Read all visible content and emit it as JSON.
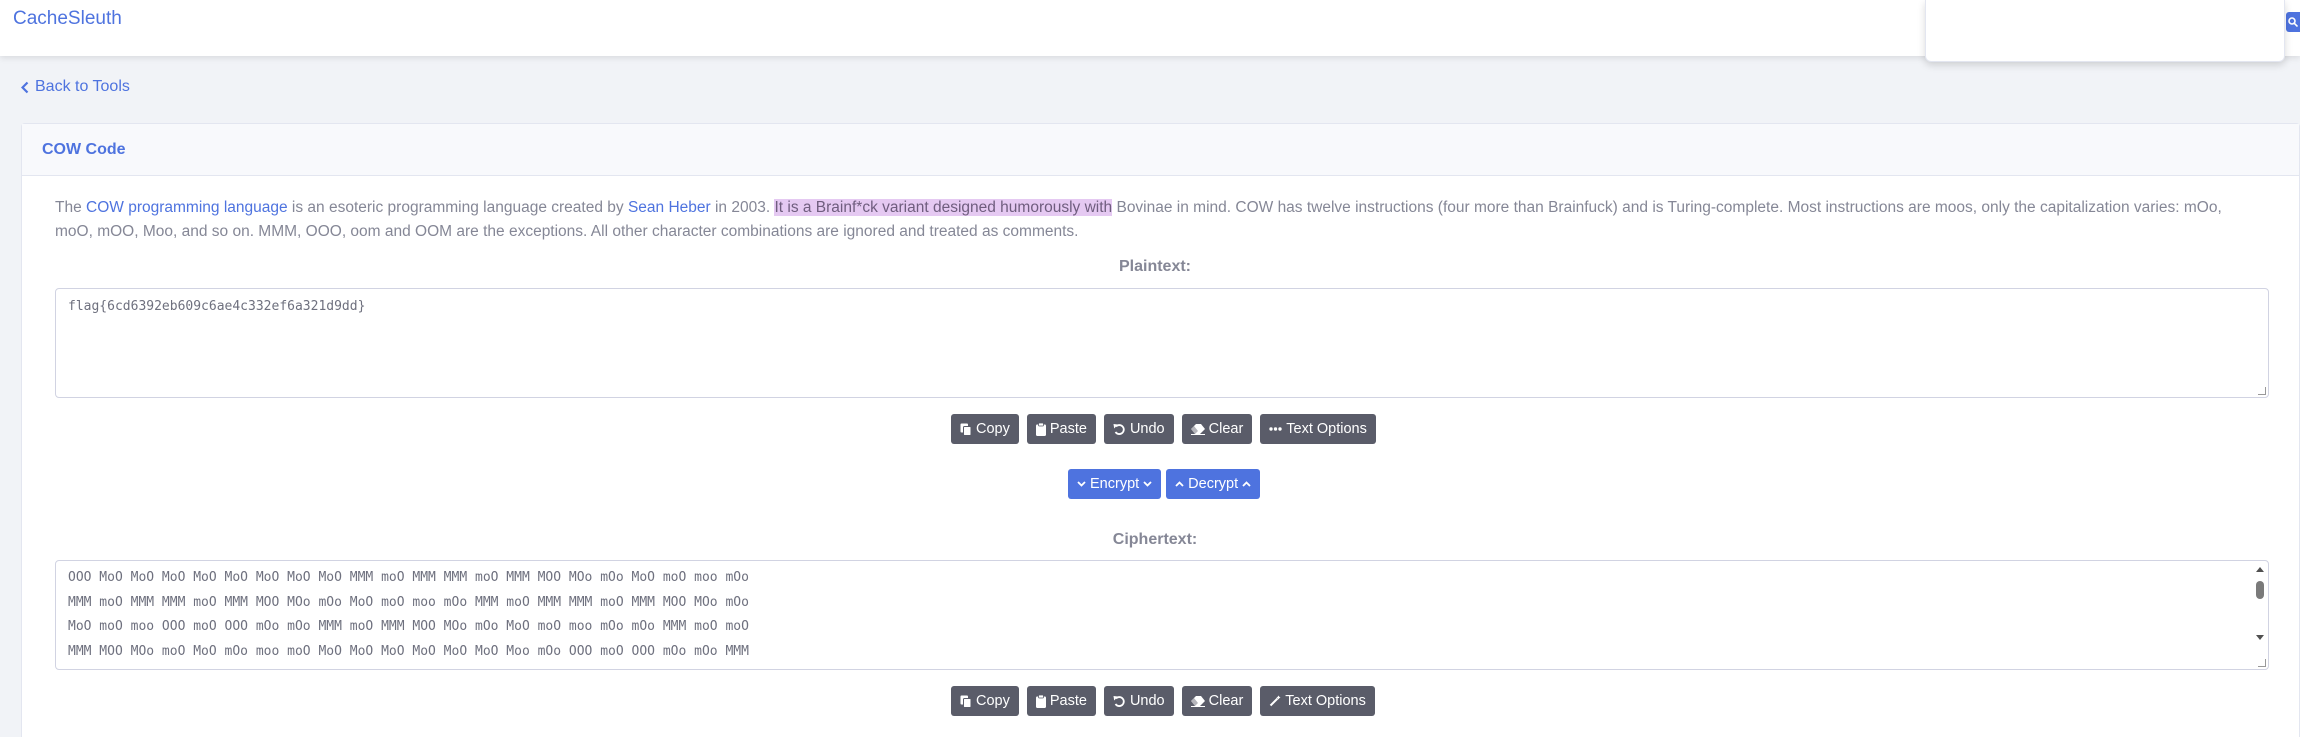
{
  "navbar": {
    "brand": "CacheSleuth"
  },
  "back_link": "Back to Tools",
  "card": {
    "title": "COW Code"
  },
  "description": {
    "part1": "The ",
    "link1": "COW programming language",
    "part2": " is an esoteric programming language created by ",
    "link2": "Sean Heber",
    "part3": " in 2003. ",
    "highlight": "It is a Brainf*ck variant designed humorously with",
    "part4": " Bovinae in mind. COW has twelve instructions (four more than Brainfuck) and is Turing-complete. Most instructions are moos, only the capitalization varies: mOo, moO, mOO, Moo, and so on. MMM, OOO, oom and OOM are the exceptions. All other character combinations are ignored and treated as comments."
  },
  "plaintext": {
    "label": "Plaintext:",
    "value": "flag{6cd6392eb609c6ae4c332ef6a321d9dd}"
  },
  "buttons_top": {
    "copy": "Copy",
    "paste": "Paste",
    "undo": "Undo",
    "clear": "Clear",
    "text_options": "Text Options"
  },
  "crypt": {
    "encrypt": "Encrypt",
    "decrypt": "Decrypt"
  },
  "ciphertext": {
    "label": "Ciphertext:",
    "lines": [
      "OOO MoO MoO MoO MoO MoO MoO MoO MoO MMM moO MMM MMM moO MMM MOO MOo mOo MoO moO moo mOo",
      "MMM moO MMM MMM moO MMM MOO MOo mOo MoO moO moo mOo MMM moO MMM MMM moO MMM MOO MOo mOo",
      "MoO moO moo OOO moO OOO mOo mOo MMM moO MMM MOO MOo mOo MoO moO moo mOo mOo MMM moO moO",
      "MMM MOO MOo moO MoO mOo moo moO MoO MoO MoO MoO MoO MoO Moo mOo OOO moO OOO mOo mOo MMM"
    ]
  },
  "buttons_bottom": {
    "copy": "Copy",
    "paste": "Paste",
    "undo": "Undo",
    "clear": "Clear",
    "text_options": "Text Options"
  },
  "colors": {
    "primary": "#4e73df",
    "secondary": "#5a5c69",
    "highlight": "#e5c9f2"
  }
}
